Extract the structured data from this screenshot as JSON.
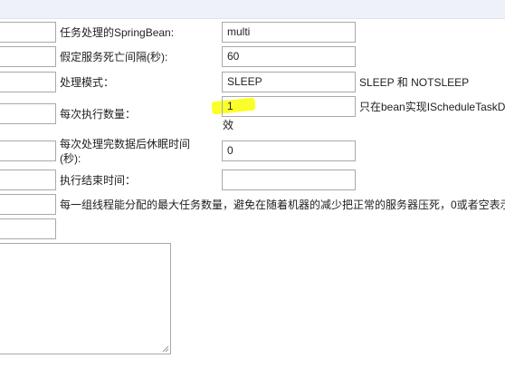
{
  "form": {
    "bean_label": "任务处理的SpringBean:",
    "bean_value": "multi",
    "dead_interval_label": "假定服务死亡间隔(秒):",
    "dead_interval_value": "60",
    "process_mode_label": "处理模式：",
    "process_mode_value": "SLEEP",
    "process_mode_hint": "SLEEP 和 NOTSLEEP",
    "batch_count_label": "每次执行数量：",
    "batch_count_value": "1",
    "batch_count_hint": "只在bean实现IScheduleTaskD",
    "batch_count_wrap": "效",
    "sleep_after_label_line1": "每次处理完数据后休眠时间",
    "sleep_after_label_line2": "(秒):",
    "sleep_after_value": "0",
    "end_time_label": "执行结束时间：",
    "end_time_value": "",
    "max_task_hint": "每一组线程能分配的最大任务数量，避免在随着机器的减少把正常的服务器压死，0或者空表示"
  },
  "colors": {
    "highlight": "#fbff1e",
    "border": "#a9a9a9",
    "topbar": "#eef2f8"
  }
}
